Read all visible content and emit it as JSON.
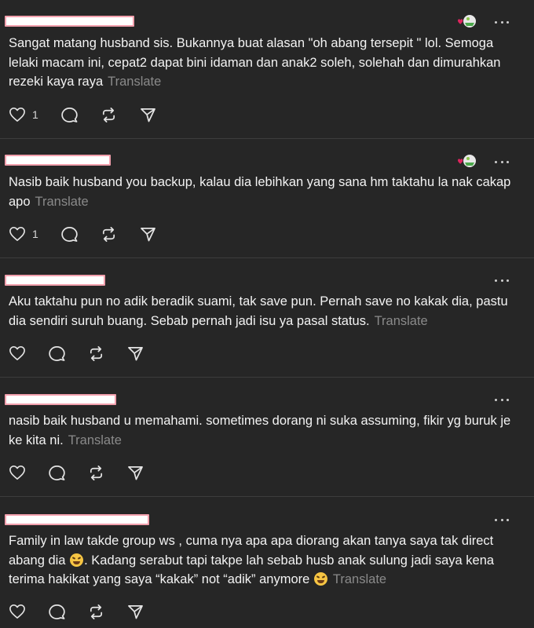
{
  "labels": {
    "translate": "Translate"
  },
  "comments": [
    {
      "text": "Sangat matang husband sis. Bukannya buat alasan \"oh abang tersepit \" lol. Semoga lelaki macam ini, cepat2 dapat bini idaman dan anak2 soleh, solehah dan dimurahkan rezeki kaya raya",
      "likes": "1",
      "has_reaction": true
    },
    {
      "text": "Nasib baik husband you backup, kalau dia lebihkan yang sana hm taktahu la nak cakap apo",
      "likes": "1",
      "has_reaction": true
    },
    {
      "text": "Aku taktahu pun no adik beradik suami, tak save pun. Pernah save no kakak dia, pastu dia sendiri suruh buang. Sebab pernah jadi isu ya pasal status.",
      "likes": "",
      "has_reaction": false
    },
    {
      "text": "nasib baik husband u memahami. sometimes dorang ni suka assuming, fikir yg buruk je ke kita ni.",
      "likes": "",
      "has_reaction": false
    },
    {
      "text_a": "Family in law takde group ws , cuma nya apa apa diorang akan tanya saya tak direct abang dia",
      "text_b": ". Kadang serabut tapi takpe lah sebab husb anak sulung jadi saya kena terima hakikat yang saya “kakak” not “adik” anymore",
      "emoji": "rolling-on-floor-laughing-emoji",
      "likes": "",
      "has_reaction": false
    }
  ],
  "icons": [
    "heart-icon",
    "comment-icon",
    "repost-icon",
    "share-icon",
    "more-icon",
    "reaction-avatar-icon"
  ],
  "colors": {
    "background": "#262626",
    "divider": "#3d3d3d",
    "text": "#f3f3f3",
    "muted": "#8a8a8a",
    "redaction": "#f2a0ad"
  }
}
